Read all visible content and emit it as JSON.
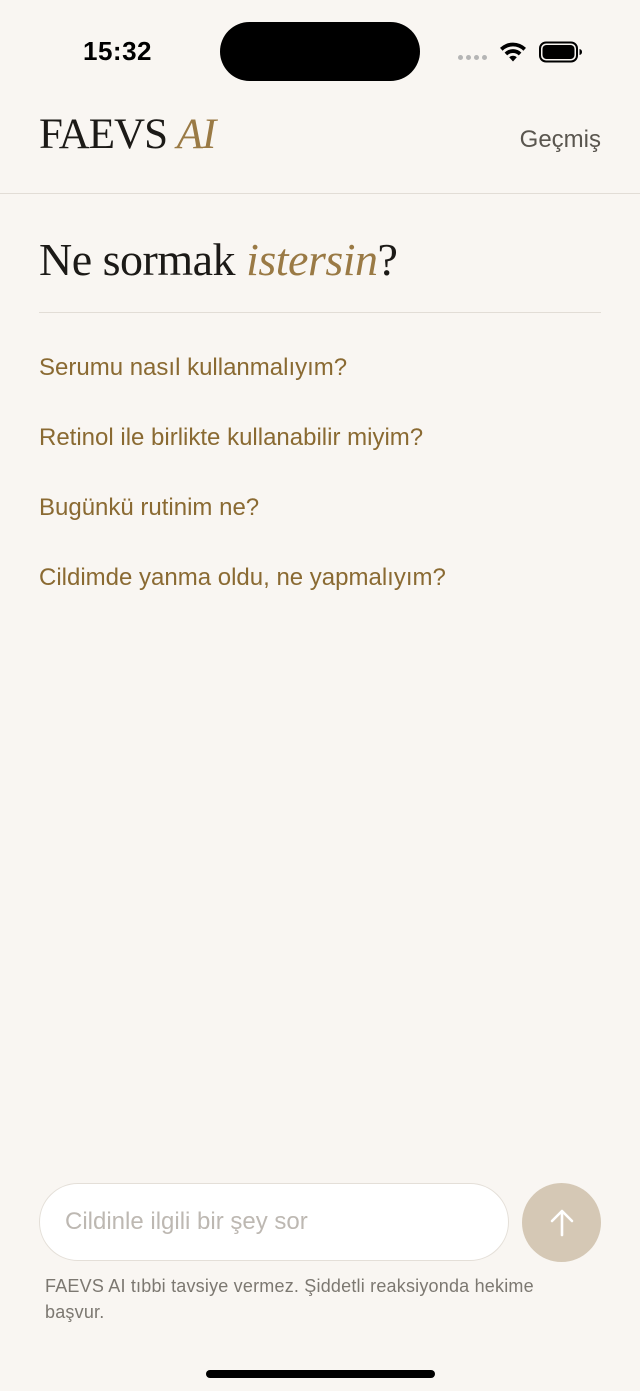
{
  "status_bar": {
    "time": "15:32"
  },
  "header": {
    "brand_main": "FAEVS ",
    "brand_accent": "AI",
    "history_label": "Geçmiş"
  },
  "main": {
    "title_prefix": "Ne sormak ",
    "title_accent": "istersin",
    "title_suffix": "?",
    "suggestions": [
      "Serumu nasıl kullanmalıyım?",
      "Retinol ile birlikte kullanabilir miyim?",
      "Bugünkü rutinim ne?",
      "Cildimde yanma oldu, ne yapmalıyım?"
    ]
  },
  "composer": {
    "placeholder": "Cildinle ilgili bir şey sor",
    "value": "",
    "send_icon": "arrow-up-icon",
    "disclaimer": "FAEVS AI tıbbi tavsiye vermez. Şiddetli reaksiyonda hekime başvur."
  },
  "colors": {
    "background": "#f9f6f2",
    "accent": "#9a7a45",
    "suggestion_text": "#8a6a32",
    "send_button": "#d5c8b5"
  }
}
